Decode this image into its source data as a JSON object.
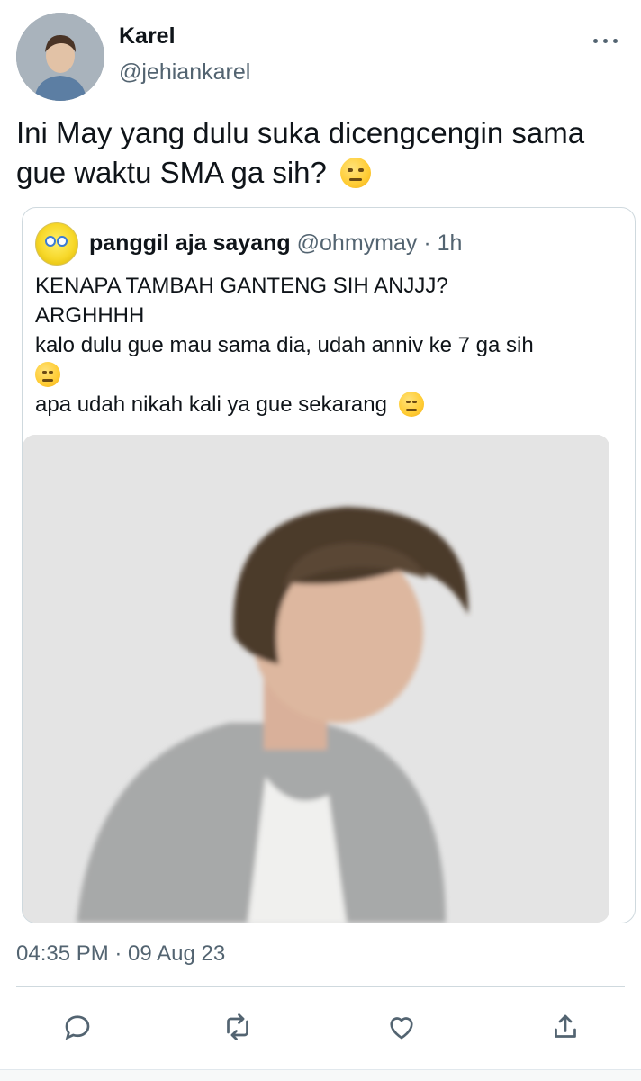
{
  "tweet": {
    "author_name": "Karel",
    "author_handle": "@jehiankarel",
    "text": "Ini May yang dulu suka dicengcengin sama gue waktu SMA ga sih?",
    "timestamp": "04:35 PM · 09 Aug 23"
  },
  "quoted_tweet": {
    "author_name": "panggil aja sayang",
    "author_handle": "@ohmymay",
    "age": "· 1h",
    "line1": "KENAPA TAMBAH GANTENG SIH ANJJJ?",
    "line2": "ARGHHHH",
    "line3": "kalo dulu gue mau sama dia, udah anniv ke 7 ga sih",
    "line4": "apa udah nikah kali ya gue sekarang"
  },
  "icons": {
    "more": "more-horizontal-icon",
    "reply": "reply-icon",
    "retweet": "retweet-icon",
    "like": "like-icon",
    "share": "share-icon"
  },
  "colors": {
    "text": "#0f1419",
    "secondary": "#536471",
    "border": "#cfd9de"
  }
}
